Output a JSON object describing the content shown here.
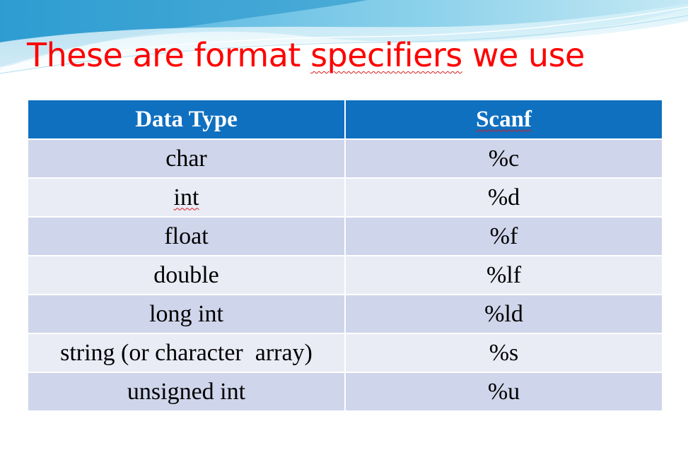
{
  "slide": {
    "title_parts": [
      "These are format ",
      "specifiers",
      " we use"
    ],
    "title_color": "#ff0000",
    "header_color": "#0f70c0",
    "row_colors": [
      "#cfd5ea",
      "#e9ebf5"
    ]
  },
  "table": {
    "headers": [
      "Data Type",
      "Scanf"
    ],
    "rows": [
      [
        "char",
        "%c"
      ],
      [
        "int",
        "%d"
      ],
      [
        "float",
        "%f"
      ],
      [
        "double",
        "%lf"
      ],
      [
        "long int",
        "%ld"
      ],
      [
        "string (or character  array)",
        "%s"
      ],
      [
        "unsigned int",
        "%u"
      ]
    ]
  }
}
